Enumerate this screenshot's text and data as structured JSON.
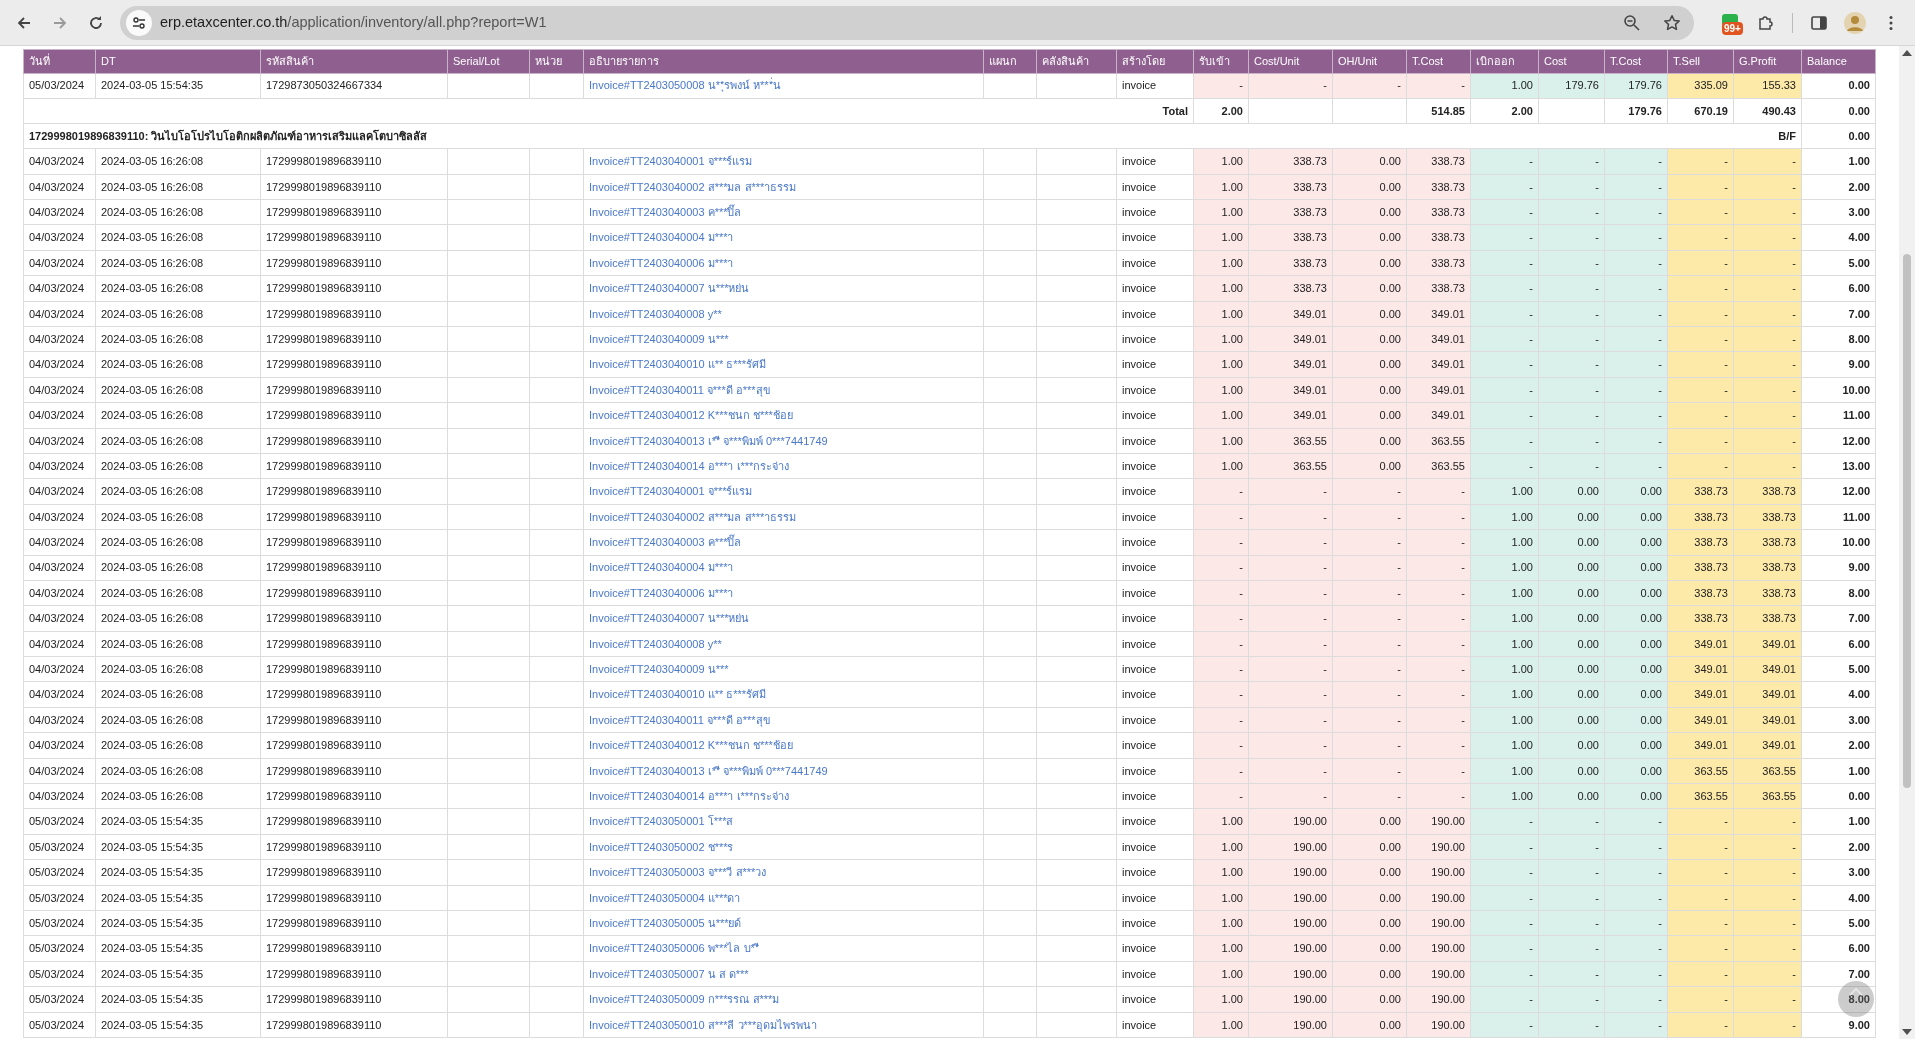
{
  "browser": {
    "url_host": "erp.etaxcenter.co.th",
    "url_path": "/application/inventory/all.php?report=W1",
    "extension_badge": "99+"
  },
  "table": {
    "columns": [
      "วันที่",
      "DT",
      "รหัสสินค้า",
      "Serial/Lot",
      "หน่วย",
      "อธิบายรายการ",
      "แผนก",
      "คลังสินค้า",
      "สร้างโดย",
      "รับเข้า",
      "Cost/Unit",
      "OH/Unit",
      "T.Cost",
      "เบิกออก",
      "Cost",
      "T.Cost",
      "T.Sell",
      "G.Profit",
      "Balance"
    ],
    "rows": [
      {
        "kind": "item",
        "date": "05/03/2024",
        "dt": "2024-03-05 15:54:35",
        "code": "1729873050324667334",
        "desc": "Invoice#TT2403050008 น**ุรพงน์ ห***่น",
        "by": "invoice",
        "in_qty": "-",
        "cost_unit": "-",
        "oh_unit": "-",
        "in_tcost": "-",
        "out_qty": "1.00",
        "out_cost": "179.76",
        "out_tcost": "179.76",
        "t_sell": "335.09",
        "g_profit": "155.33",
        "balance": "0.00"
      },
      {
        "kind": "total",
        "label": "Total",
        "in_qty": "2.00",
        "in_tcost": "514.85",
        "out_qty": "2.00",
        "out_tcost": "179.76",
        "t_sell": "670.19",
        "g_profit": "490.43",
        "balance": "0.00"
      },
      {
        "kind": "group",
        "title": "1729998019896839110: วินไบโอโปรไบโอติกผลิตภัณฑ์อาหารเสริมแลคโตบาซิลลัส",
        "bf_label": "B/F",
        "balance": "0.00"
      },
      {
        "kind": "item",
        "date": "04/03/2024",
        "dt": "2024-03-05 16:26:08",
        "code": "1729998019896839110",
        "desc": "Invoice#TT2403040001 จ***ร์แรม",
        "by": "invoice",
        "in_qty": "1.00",
        "cost_unit": "338.73",
        "oh_unit": "0.00",
        "in_tcost": "338.73",
        "out_qty": "-",
        "out_cost": "-",
        "out_tcost": "-",
        "t_sell": "-",
        "g_profit": "-",
        "balance": "1.00"
      },
      {
        "kind": "item",
        "date": "04/03/2024",
        "dt": "2024-03-05 16:26:08",
        "code": "1729998019896839110",
        "desc": "Invoice#TT2403040002 ส***มล ส***าธรรม",
        "by": "invoice",
        "in_qty": "1.00",
        "cost_unit": "338.73",
        "oh_unit": "0.00",
        "in_tcost": "338.73",
        "out_qty": "-",
        "out_cost": "-",
        "out_tcost": "-",
        "t_sell": "-",
        "g_profit": "-",
        "balance": "2.00"
      },
      {
        "kind": "item",
        "date": "04/03/2024",
        "dt": "2024-03-05 16:26:08",
        "code": "1729998019896839110",
        "desc": "Invoice#TT2403040003 ค***ปิ๊ล",
        "by": "invoice",
        "in_qty": "1.00",
        "cost_unit": "338.73",
        "oh_unit": "0.00",
        "in_tcost": "338.73",
        "out_qty": "-",
        "out_cost": "-",
        "out_tcost": "-",
        "t_sell": "-",
        "g_profit": "-",
        "balance": "3.00"
      },
      {
        "kind": "item",
        "date": "04/03/2024",
        "dt": "2024-03-05 16:26:08",
        "code": "1729998019896839110",
        "desc": "Invoice#TT2403040004 ม***า",
        "by": "invoice",
        "in_qty": "1.00",
        "cost_unit": "338.73",
        "oh_unit": "0.00",
        "in_tcost": "338.73",
        "out_qty": "-",
        "out_cost": "-",
        "out_tcost": "-",
        "t_sell": "-",
        "g_profit": "-",
        "balance": "4.00"
      },
      {
        "kind": "item",
        "date": "04/03/2024",
        "dt": "2024-03-05 16:26:08",
        "code": "1729998019896839110",
        "desc": "Invoice#TT2403040006 ม***า",
        "by": "invoice",
        "in_qty": "1.00",
        "cost_unit": "338.73",
        "oh_unit": "0.00",
        "in_tcost": "338.73",
        "out_qty": "-",
        "out_cost": "-",
        "out_tcost": "-",
        "t_sell": "-",
        "g_profit": "-",
        "balance": "5.00"
      },
      {
        "kind": "item",
        "date": "04/03/2024",
        "dt": "2024-03-05 16:26:08",
        "code": "1729998019896839110",
        "desc": "Invoice#TT2403040007 น***หย่น",
        "by": "invoice",
        "in_qty": "1.00",
        "cost_unit": "338.73",
        "oh_unit": "0.00",
        "in_tcost": "338.73",
        "out_qty": "-",
        "out_cost": "-",
        "out_tcost": "-",
        "t_sell": "-",
        "g_profit": "-",
        "balance": "6.00"
      },
      {
        "kind": "item",
        "date": "04/03/2024",
        "dt": "2024-03-05 16:26:08",
        "code": "1729998019896839110",
        "desc": "Invoice#TT2403040008 y**",
        "by": "invoice",
        "in_qty": "1.00",
        "cost_unit": "349.01",
        "oh_unit": "0.00",
        "in_tcost": "349.01",
        "out_qty": "-",
        "out_cost": "-",
        "out_tcost": "-",
        "t_sell": "-",
        "g_profit": "-",
        "balance": "7.00"
      },
      {
        "kind": "item",
        "date": "04/03/2024",
        "dt": "2024-03-05 16:26:08",
        "code": "1729998019896839110",
        "desc": "Invoice#TT2403040009 น***",
        "by": "invoice",
        "in_qty": "1.00",
        "cost_unit": "349.01",
        "oh_unit": "0.00",
        "in_tcost": "349.01",
        "out_qty": "-",
        "out_cost": "-",
        "out_tcost": "-",
        "t_sell": "-",
        "g_profit": "-",
        "balance": "8.00"
      },
      {
        "kind": "item",
        "date": "04/03/2024",
        "dt": "2024-03-05 16:26:08",
        "code": "1729998019896839110",
        "desc": "Invoice#TT2403040010 แ** ธ***รัศมี",
        "by": "invoice",
        "in_qty": "1.00",
        "cost_unit": "349.01",
        "oh_unit": "0.00",
        "in_tcost": "349.01",
        "out_qty": "-",
        "out_cost": "-",
        "out_tcost": "-",
        "t_sell": "-",
        "g_profit": "-",
        "balance": "9.00"
      },
      {
        "kind": "item",
        "date": "04/03/2024",
        "dt": "2024-03-05 16:26:08",
        "code": "1729998019896839110",
        "desc": "Invoice#TT2403040011 จ***ดี อ***สุข",
        "by": "invoice",
        "in_qty": "1.00",
        "cost_unit": "349.01",
        "oh_unit": "0.00",
        "in_tcost": "349.01",
        "out_qty": "-",
        "out_cost": "-",
        "out_tcost": "-",
        "t_sell": "-",
        "g_profit": "-",
        "balance": "10.00"
      },
      {
        "kind": "item",
        "date": "04/03/2024",
        "dt": "2024-03-05 16:26:08",
        "code": "1729998019896839110",
        "desc": "Invoice#TT2403040012 K***ชนก ช***ช้อย",
        "by": "invoice",
        "in_qty": "1.00",
        "cost_unit": "349.01",
        "oh_unit": "0.00",
        "in_tcost": "349.01",
        "out_qty": "-",
        "out_cost": "-",
        "out_tcost": "-",
        "t_sell": "-",
        "g_profit": "-",
        "balance": "11.00"
      },
      {
        "kind": "item",
        "date": "04/03/2024",
        "dt": "2024-03-05 16:26:08",
        "code": "1729998019896839110",
        "desc": "Invoice#TT2403040013 เ**ี จ***พิมพ์ 0***7441749",
        "by": "invoice",
        "in_qty": "1.00",
        "cost_unit": "363.55",
        "oh_unit": "0.00",
        "in_tcost": "363.55",
        "out_qty": "-",
        "out_cost": "-",
        "out_tcost": "-",
        "t_sell": "-",
        "g_profit": "-",
        "balance": "12.00"
      },
      {
        "kind": "item",
        "date": "04/03/2024",
        "dt": "2024-03-05 16:26:08",
        "code": "1729998019896839110",
        "desc": "Invoice#TT2403040014 อ***า เ***กระจ่าง",
        "by": "invoice",
        "in_qty": "1.00",
        "cost_unit": "363.55",
        "oh_unit": "0.00",
        "in_tcost": "363.55",
        "out_qty": "-",
        "out_cost": "-",
        "out_tcost": "-",
        "t_sell": "-",
        "g_profit": "-",
        "balance": "13.00"
      },
      {
        "kind": "item",
        "date": "04/03/2024",
        "dt": "2024-03-05 16:26:08",
        "code": "1729998019896839110",
        "desc": "Invoice#TT2403040001 จ***ร์แรม",
        "by": "invoice",
        "in_qty": "-",
        "cost_unit": "-",
        "oh_unit": "-",
        "in_tcost": "-",
        "out_qty": "1.00",
        "out_cost": "0.00",
        "out_tcost": "0.00",
        "t_sell": "338.73",
        "g_profit": "338.73",
        "balance": "12.00"
      },
      {
        "kind": "item",
        "date": "04/03/2024",
        "dt": "2024-03-05 16:26:08",
        "code": "1729998019896839110",
        "desc": "Invoice#TT2403040002 ส***มล ส***าธรรม",
        "by": "invoice",
        "in_qty": "-",
        "cost_unit": "-",
        "oh_unit": "-",
        "in_tcost": "-",
        "out_qty": "1.00",
        "out_cost": "0.00",
        "out_tcost": "0.00",
        "t_sell": "338.73",
        "g_profit": "338.73",
        "balance": "11.00"
      },
      {
        "kind": "item",
        "date": "04/03/2024",
        "dt": "2024-03-05 16:26:08",
        "code": "1729998019896839110",
        "desc": "Invoice#TT2403040003 ค***ปิ๊ล",
        "by": "invoice",
        "in_qty": "-",
        "cost_unit": "-",
        "oh_unit": "-",
        "in_tcost": "-",
        "out_qty": "1.00",
        "out_cost": "0.00",
        "out_tcost": "0.00",
        "t_sell": "338.73",
        "g_profit": "338.73",
        "balance": "10.00"
      },
      {
        "kind": "item",
        "date": "04/03/2024",
        "dt": "2024-03-05 16:26:08",
        "code": "1729998019896839110",
        "desc": "Invoice#TT2403040004 ม***า",
        "by": "invoice",
        "in_qty": "-",
        "cost_unit": "-",
        "oh_unit": "-",
        "in_tcost": "-",
        "out_qty": "1.00",
        "out_cost": "0.00",
        "out_tcost": "0.00",
        "t_sell": "338.73",
        "g_profit": "338.73",
        "balance": "9.00"
      },
      {
        "kind": "item",
        "date": "04/03/2024",
        "dt": "2024-03-05 16:26:08",
        "code": "1729998019896839110",
        "desc": "Invoice#TT2403040006 ม***า",
        "by": "invoice",
        "in_qty": "-",
        "cost_unit": "-",
        "oh_unit": "-",
        "in_tcost": "-",
        "out_qty": "1.00",
        "out_cost": "0.00",
        "out_tcost": "0.00",
        "t_sell": "338.73",
        "g_profit": "338.73",
        "balance": "8.00"
      },
      {
        "kind": "item",
        "date": "04/03/2024",
        "dt": "2024-03-05 16:26:08",
        "code": "1729998019896839110",
        "desc": "Invoice#TT2403040007 น***หย่น",
        "by": "invoice",
        "in_qty": "-",
        "cost_unit": "-",
        "oh_unit": "-",
        "in_tcost": "-",
        "out_qty": "1.00",
        "out_cost": "0.00",
        "out_tcost": "0.00",
        "t_sell": "338.73",
        "g_profit": "338.73",
        "balance": "7.00"
      },
      {
        "kind": "item",
        "date": "04/03/2024",
        "dt": "2024-03-05 16:26:08",
        "code": "1729998019896839110",
        "desc": "Invoice#TT2403040008 y**",
        "by": "invoice",
        "in_qty": "-",
        "cost_unit": "-",
        "oh_unit": "-",
        "in_tcost": "-",
        "out_qty": "1.00",
        "out_cost": "0.00",
        "out_tcost": "0.00",
        "t_sell": "349.01",
        "g_profit": "349.01",
        "balance": "6.00"
      },
      {
        "kind": "item",
        "date": "04/03/2024",
        "dt": "2024-03-05 16:26:08",
        "code": "1729998019896839110",
        "desc": "Invoice#TT2403040009 น***",
        "by": "invoice",
        "in_qty": "-",
        "cost_unit": "-",
        "oh_unit": "-",
        "in_tcost": "-",
        "out_qty": "1.00",
        "out_cost": "0.00",
        "out_tcost": "0.00",
        "t_sell": "349.01",
        "g_profit": "349.01",
        "balance": "5.00"
      },
      {
        "kind": "item",
        "date": "04/03/2024",
        "dt": "2024-03-05 16:26:08",
        "code": "1729998019896839110",
        "desc": "Invoice#TT2403040010 แ** ธ***รัศมี",
        "by": "invoice",
        "in_qty": "-",
        "cost_unit": "-",
        "oh_unit": "-",
        "in_tcost": "-",
        "out_qty": "1.00",
        "out_cost": "0.00",
        "out_tcost": "0.00",
        "t_sell": "349.01",
        "g_profit": "349.01",
        "balance": "4.00"
      },
      {
        "kind": "item",
        "date": "04/03/2024",
        "dt": "2024-03-05 16:26:08",
        "code": "1729998019896839110",
        "desc": "Invoice#TT2403040011 จ***ดี อ***สุข",
        "by": "invoice",
        "in_qty": "-",
        "cost_unit": "-",
        "oh_unit": "-",
        "in_tcost": "-",
        "out_qty": "1.00",
        "out_cost": "0.00",
        "out_tcost": "0.00",
        "t_sell": "349.01",
        "g_profit": "349.01",
        "balance": "3.00"
      },
      {
        "kind": "item",
        "date": "04/03/2024",
        "dt": "2024-03-05 16:26:08",
        "code": "1729998019896839110",
        "desc": "Invoice#TT2403040012 K***ชนก ช***ช้อย",
        "by": "invoice",
        "in_qty": "-",
        "cost_unit": "-",
        "oh_unit": "-",
        "in_tcost": "-",
        "out_qty": "1.00",
        "out_cost": "0.00",
        "out_tcost": "0.00",
        "t_sell": "349.01",
        "g_profit": "349.01",
        "balance": "2.00"
      },
      {
        "kind": "item",
        "date": "04/03/2024",
        "dt": "2024-03-05 16:26:08",
        "code": "1729998019896839110",
        "desc": "Invoice#TT2403040013 เ**ี จ***พิมพ์ 0***7441749",
        "by": "invoice",
        "in_qty": "-",
        "cost_unit": "-",
        "oh_unit": "-",
        "in_tcost": "-",
        "out_qty": "1.00",
        "out_cost": "0.00",
        "out_tcost": "0.00",
        "t_sell": "363.55",
        "g_profit": "363.55",
        "balance": "1.00"
      },
      {
        "kind": "item",
        "date": "04/03/2024",
        "dt": "2024-03-05 16:26:08",
        "code": "1729998019896839110",
        "desc": "Invoice#TT2403040014 อ***า เ***กระจ่าง",
        "by": "invoice",
        "in_qty": "-",
        "cost_unit": "-",
        "oh_unit": "-",
        "in_tcost": "-",
        "out_qty": "1.00",
        "out_cost": "0.00",
        "out_tcost": "0.00",
        "t_sell": "363.55",
        "g_profit": "363.55",
        "balance": "0.00"
      },
      {
        "kind": "item",
        "date": "05/03/2024",
        "dt": "2024-03-05 15:54:35",
        "code": "1729998019896839110",
        "desc": "Invoice#TT2403050001 โ***ส",
        "by": "invoice",
        "in_qty": "1.00",
        "cost_unit": "190.00",
        "oh_unit": "0.00",
        "in_tcost": "190.00",
        "out_qty": "-",
        "out_cost": "-",
        "out_tcost": "-",
        "t_sell": "-",
        "g_profit": "-",
        "balance": "1.00"
      },
      {
        "kind": "item",
        "date": "05/03/2024",
        "dt": "2024-03-05 15:54:35",
        "code": "1729998019896839110",
        "desc": "Invoice#TT2403050002 ช***ร",
        "by": "invoice",
        "in_qty": "1.00",
        "cost_unit": "190.00",
        "oh_unit": "0.00",
        "in_tcost": "190.00",
        "out_qty": "-",
        "out_cost": "-",
        "out_tcost": "-",
        "t_sell": "-",
        "g_profit": "-",
        "balance": "2.00"
      },
      {
        "kind": "item",
        "date": "05/03/2024",
        "dt": "2024-03-05 15:54:35",
        "code": "1729998019896839110",
        "desc": "Invoice#TT2403050003 จ***วี ส***วง",
        "by": "invoice",
        "in_qty": "1.00",
        "cost_unit": "190.00",
        "oh_unit": "0.00",
        "in_tcost": "190.00",
        "out_qty": "-",
        "out_cost": "-",
        "out_tcost": "-",
        "t_sell": "-",
        "g_profit": "-",
        "balance": "3.00"
      },
      {
        "kind": "item",
        "date": "05/03/2024",
        "dt": "2024-03-05 15:54:35",
        "code": "1729998019896839110",
        "desc": "Invoice#TT2403050004 แ***ดา",
        "by": "invoice",
        "in_qty": "1.00",
        "cost_unit": "190.00",
        "oh_unit": "0.00",
        "in_tcost": "190.00",
        "out_qty": "-",
        "out_cost": "-",
        "out_tcost": "-",
        "t_sell": "-",
        "g_profit": "-",
        "balance": "4.00"
      },
      {
        "kind": "item",
        "date": "05/03/2024",
        "dt": "2024-03-05 15:54:35",
        "code": "1729998019896839110",
        "desc": "Invoice#TT2403050005 น***ยด์",
        "by": "invoice",
        "in_qty": "1.00",
        "cost_unit": "190.00",
        "oh_unit": "0.00",
        "in_tcost": "190.00",
        "out_qty": "-",
        "out_cost": "-",
        "out_tcost": "-",
        "t_sell": "-",
        "g_profit": "-",
        "balance": "5.00"
      },
      {
        "kind": "item",
        "date": "05/03/2024",
        "dt": "2024-03-05 15:54:35",
        "code": "1729998019896839110",
        "desc": "Invoice#TT2403050006 พ***ไล บ**ี",
        "by": "invoice",
        "in_qty": "1.00",
        "cost_unit": "190.00",
        "oh_unit": "0.00",
        "in_tcost": "190.00",
        "out_qty": "-",
        "out_cost": "-",
        "out_tcost": "-",
        "t_sell": "-",
        "g_profit": "-",
        "balance": "6.00"
      },
      {
        "kind": "item",
        "date": "05/03/2024",
        "dt": "2024-03-05 15:54:35",
        "code": "1729998019896839110",
        "desc": "Invoice#TT2403050007 น ส ด***",
        "by": "invoice",
        "in_qty": "1.00",
        "cost_unit": "190.00",
        "oh_unit": "0.00",
        "in_tcost": "190.00",
        "out_qty": "-",
        "out_cost": "-",
        "out_tcost": "-",
        "t_sell": "-",
        "g_profit": "-",
        "balance": "7.00"
      },
      {
        "kind": "item",
        "date": "05/03/2024",
        "dt": "2024-03-05 15:54:35",
        "code": "1729998019896839110",
        "desc": "Invoice#TT2403050009 ก***รรณ ส***ม",
        "by": "invoice",
        "in_qty": "1.00",
        "cost_unit": "190.00",
        "oh_unit": "0.00",
        "in_tcost": "190.00",
        "out_qty": "-",
        "out_cost": "-",
        "out_tcost": "-",
        "t_sell": "-",
        "g_profit": "-",
        "balance": "8.00"
      },
      {
        "kind": "item",
        "date": "05/03/2024",
        "dt": "2024-03-05 15:54:35",
        "code": "1729998019896839110",
        "desc": "Invoice#TT2403050010 ส***ลี ว***อุดมไพรพนา",
        "by": "invoice",
        "in_qty": "1.00",
        "cost_unit": "190.00",
        "oh_unit": "0.00",
        "in_tcost": "190.00",
        "out_qty": "-",
        "out_cost": "-",
        "out_tcost": "-",
        "t_sell": "-",
        "g_profit": "-",
        "balance": "9.00"
      }
    ]
  }
}
